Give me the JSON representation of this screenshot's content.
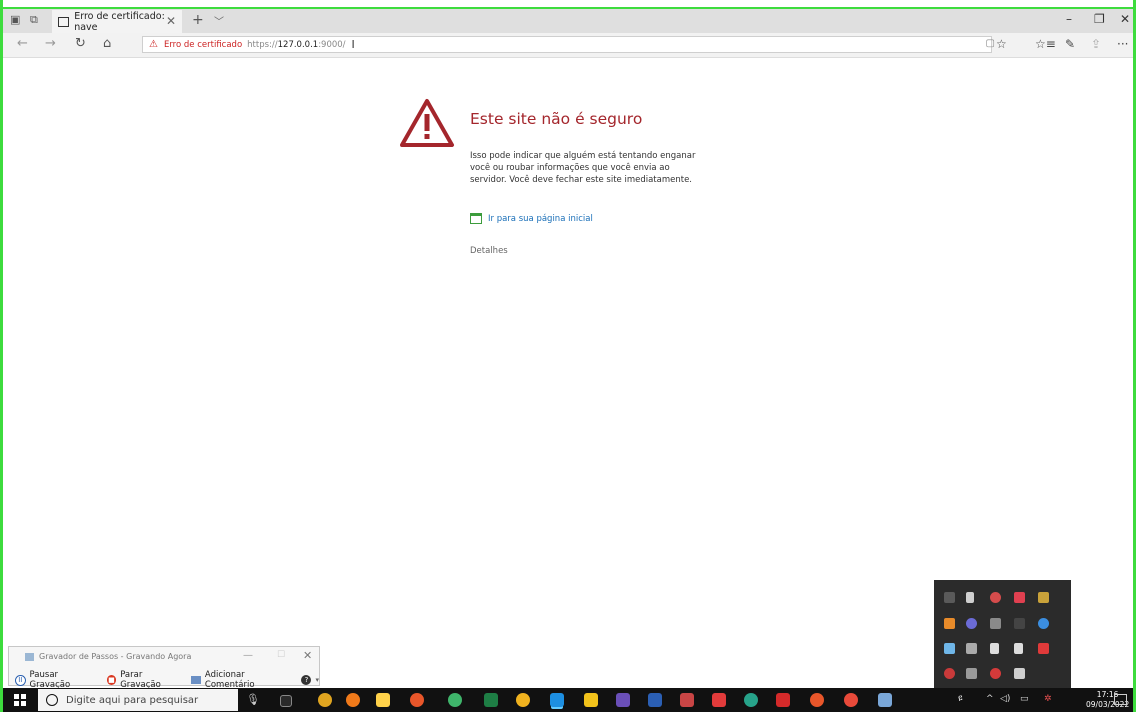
{
  "browser": {
    "tab_title": "Erro de certificado: nave",
    "address": {
      "error_label": "Erro de certificado",
      "protocol": "https://",
      "host": "127.0.0.1",
      "port": ":9000/"
    }
  },
  "page": {
    "title": "Este site não é seguro",
    "body": "Isso pode indicar que alguém está tentando enganar você ou roubar informações que você envia ao servidor. Você deve fechar este site imediatamente.",
    "home_link": "Ir para sua página inicial",
    "details": "Detalhes"
  },
  "recorder": {
    "title": "Gravador de Passos - Gravando Agora",
    "pause": "Pausar Gravação",
    "stop": "Parar Gravação",
    "comment": "Adicionar Comentário"
  },
  "taskbar": {
    "search_placeholder": "Digite aqui para pesquisar",
    "time": "17:16",
    "date": "09/03/2022"
  },
  "colors": {
    "error_red": "#a4262c",
    "link_blue": "#1a6fb8",
    "frame_green": "#3ddc3d"
  }
}
